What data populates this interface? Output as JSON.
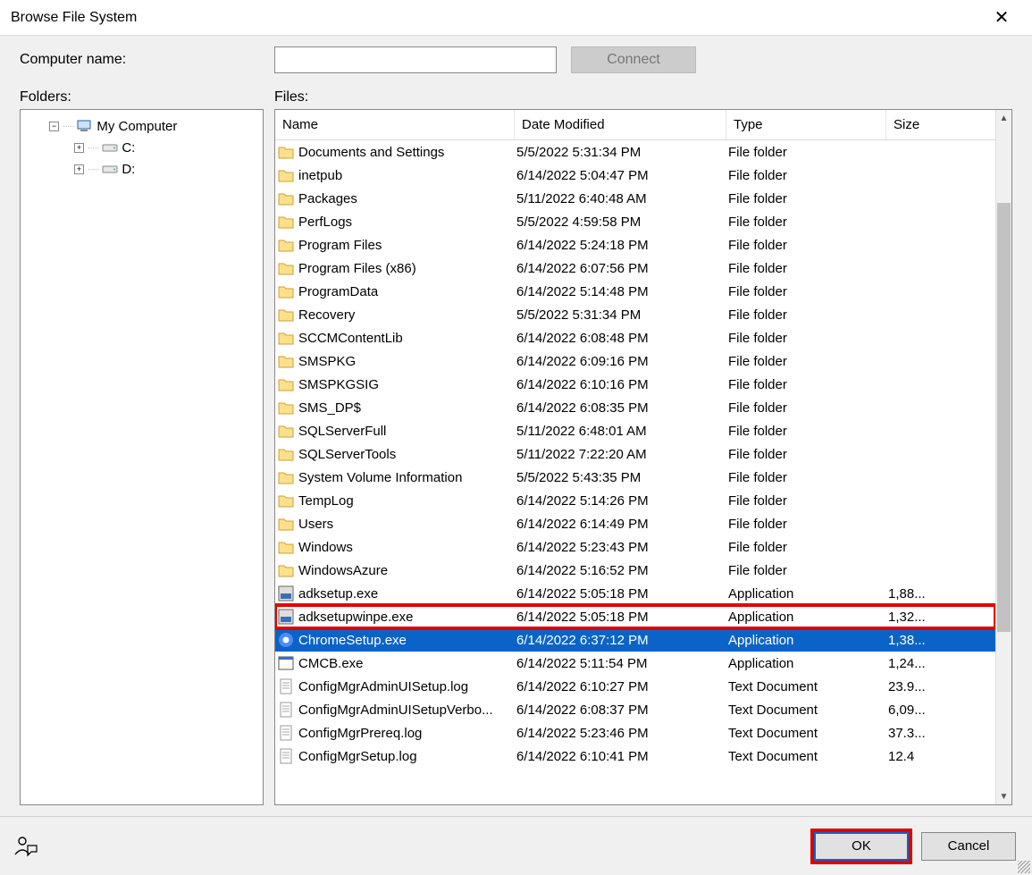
{
  "titlebar": {
    "title": "Browse File System",
    "close_glyph": "✕"
  },
  "top": {
    "computer_label": "Computer name:",
    "computer_value": "",
    "connect_label": "Connect"
  },
  "labels": {
    "folders": "Folders:",
    "files": "Files:"
  },
  "tree": {
    "root": {
      "label": "My Computer",
      "exp": "⊟"
    },
    "children": [
      {
        "label": "C:",
        "exp": "⊞"
      },
      {
        "label": "D:",
        "exp": "⊞"
      }
    ]
  },
  "columns": {
    "name": "Name",
    "date": "Date Modified",
    "type": "Type",
    "size": "Size"
  },
  "files": [
    {
      "name": "Documents and Settings",
      "date": "5/5/2022 5:31:34 PM",
      "type": "File folder",
      "size": "",
      "icon": "folder"
    },
    {
      "name": "inetpub",
      "date": "6/14/2022 5:04:47 PM",
      "type": "File folder",
      "size": "",
      "icon": "folder"
    },
    {
      "name": "Packages",
      "date": "5/11/2022 6:40:48 AM",
      "type": "File folder",
      "size": "",
      "icon": "folder"
    },
    {
      "name": "PerfLogs",
      "date": "5/5/2022 4:59:58 PM",
      "type": "File folder",
      "size": "",
      "icon": "folder"
    },
    {
      "name": "Program Files",
      "date": "6/14/2022 5:24:18 PM",
      "type": "File folder",
      "size": "",
      "icon": "folder"
    },
    {
      "name": "Program Files (x86)",
      "date": "6/14/2022 6:07:56 PM",
      "type": "File folder",
      "size": "",
      "icon": "folder"
    },
    {
      "name": "ProgramData",
      "date": "6/14/2022 5:14:48 PM",
      "type": "File folder",
      "size": "",
      "icon": "folder"
    },
    {
      "name": "Recovery",
      "date": "5/5/2022 5:31:34 PM",
      "type": "File folder",
      "size": "",
      "icon": "folder"
    },
    {
      "name": "SCCMContentLib",
      "date": "6/14/2022 6:08:48 PM",
      "type": "File folder",
      "size": "",
      "icon": "folder"
    },
    {
      "name": "SMSPKG",
      "date": "6/14/2022 6:09:16 PM",
      "type": "File folder",
      "size": "",
      "icon": "folder"
    },
    {
      "name": "SMSPKGSIG",
      "date": "6/14/2022 6:10:16 PM",
      "type": "File folder",
      "size": "",
      "icon": "folder"
    },
    {
      "name": "SMS_DP$",
      "date": "6/14/2022 6:08:35 PM",
      "type": "File folder",
      "size": "",
      "icon": "folder"
    },
    {
      "name": "SQLServerFull",
      "date": "5/11/2022 6:48:01 AM",
      "type": "File folder",
      "size": "",
      "icon": "folder"
    },
    {
      "name": "SQLServerTools",
      "date": "5/11/2022 7:22:20 AM",
      "type": "File folder",
      "size": "",
      "icon": "folder"
    },
    {
      "name": "System Volume Information",
      "date": "5/5/2022 5:43:35 PM",
      "type": "File folder",
      "size": "",
      "icon": "folder"
    },
    {
      "name": "TempLog",
      "date": "6/14/2022 5:14:26 PM",
      "type": "File folder",
      "size": "",
      "icon": "folder"
    },
    {
      "name": "Users",
      "date": "6/14/2022 6:14:49 PM",
      "type": "File folder",
      "size": "",
      "icon": "folder"
    },
    {
      "name": "Windows",
      "date": "6/14/2022 5:23:43 PM",
      "type": "File folder",
      "size": "",
      "icon": "folder"
    },
    {
      "name": "WindowsAzure",
      "date": "6/14/2022 5:16:52 PM",
      "type": "File folder",
      "size": "",
      "icon": "folder"
    },
    {
      "name": "adksetup.exe",
      "date": "6/14/2022 5:05:18 PM",
      "type": "Application",
      "size": "1,88...",
      "icon": "installer"
    },
    {
      "name": "adksetupwinpe.exe",
      "date": "6/14/2022 5:05:18 PM",
      "type": "Application",
      "size": "1,32...",
      "icon": "installer",
      "highlight": true
    },
    {
      "name": "ChromeSetup.exe",
      "date": "6/14/2022 6:37:12 PM",
      "type": "Application",
      "size": "1,38...",
      "icon": "chrome",
      "selected": true
    },
    {
      "name": "CMCB.exe",
      "date": "6/14/2022 5:11:54 PM",
      "type": "Application",
      "size": "1,24...",
      "icon": "app"
    },
    {
      "name": "ConfigMgrAdminUISetup.log",
      "date": "6/14/2022 6:10:27 PM",
      "type": "Text Document",
      "size": "23.9...",
      "icon": "text"
    },
    {
      "name": "ConfigMgrAdminUISetupVerbo...",
      "date": "6/14/2022 6:08:37 PM",
      "type": "Text Document",
      "size": "6,09...",
      "icon": "text"
    },
    {
      "name": "ConfigMgrPrereq.log",
      "date": "6/14/2022 5:23:46 PM",
      "type": "Text Document",
      "size": "37.3...",
      "icon": "text"
    },
    {
      "name": "ConfigMgrSetup.log",
      "date": "6/14/2022 6:10:41 PM",
      "type": "Text Document",
      "size": "12.4",
      "icon": "text"
    }
  ],
  "buttons": {
    "ok": "OK",
    "cancel": "Cancel"
  },
  "scroll": {
    "up": "▲",
    "down": "▼"
  }
}
